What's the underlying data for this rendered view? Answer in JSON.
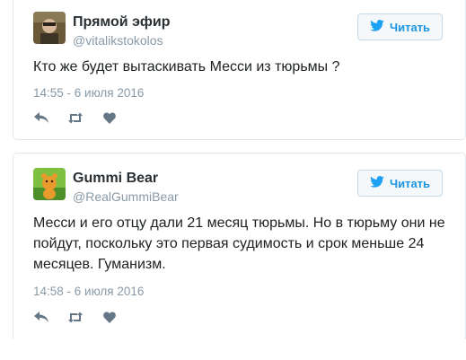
{
  "colors": {
    "name": "#292f33",
    "muted": "#8899a6",
    "follow": "#1b95e0",
    "icon": "#657786",
    "border": "#e1e8ed"
  },
  "tweets": [
    {
      "name": "Прямой эфир",
      "handle": "@vitalikstokolos",
      "text": "Кто же будет вытаскивать Месси из тюрьмы ?",
      "timestamp": "14:55 - 6 июля 2016",
      "follow_label": "Читать",
      "icons": [
        "reply-icon",
        "retweet-icon",
        "like-icon"
      ]
    },
    {
      "name": "Gummi Bear",
      "handle": "@RealGummiBear",
      "text": "Месси и его отцу дали 21 месяц тюрьмы. Но в тюрьму они не пойдут, поскольку это первая судимость и срок меньше 24 месяцев. Гуманизм.",
      "timestamp": "14:58 - 6 июля 2016",
      "follow_label": "Читать",
      "icons": [
        "reply-icon",
        "retweet-icon",
        "like-icon"
      ]
    }
  ]
}
